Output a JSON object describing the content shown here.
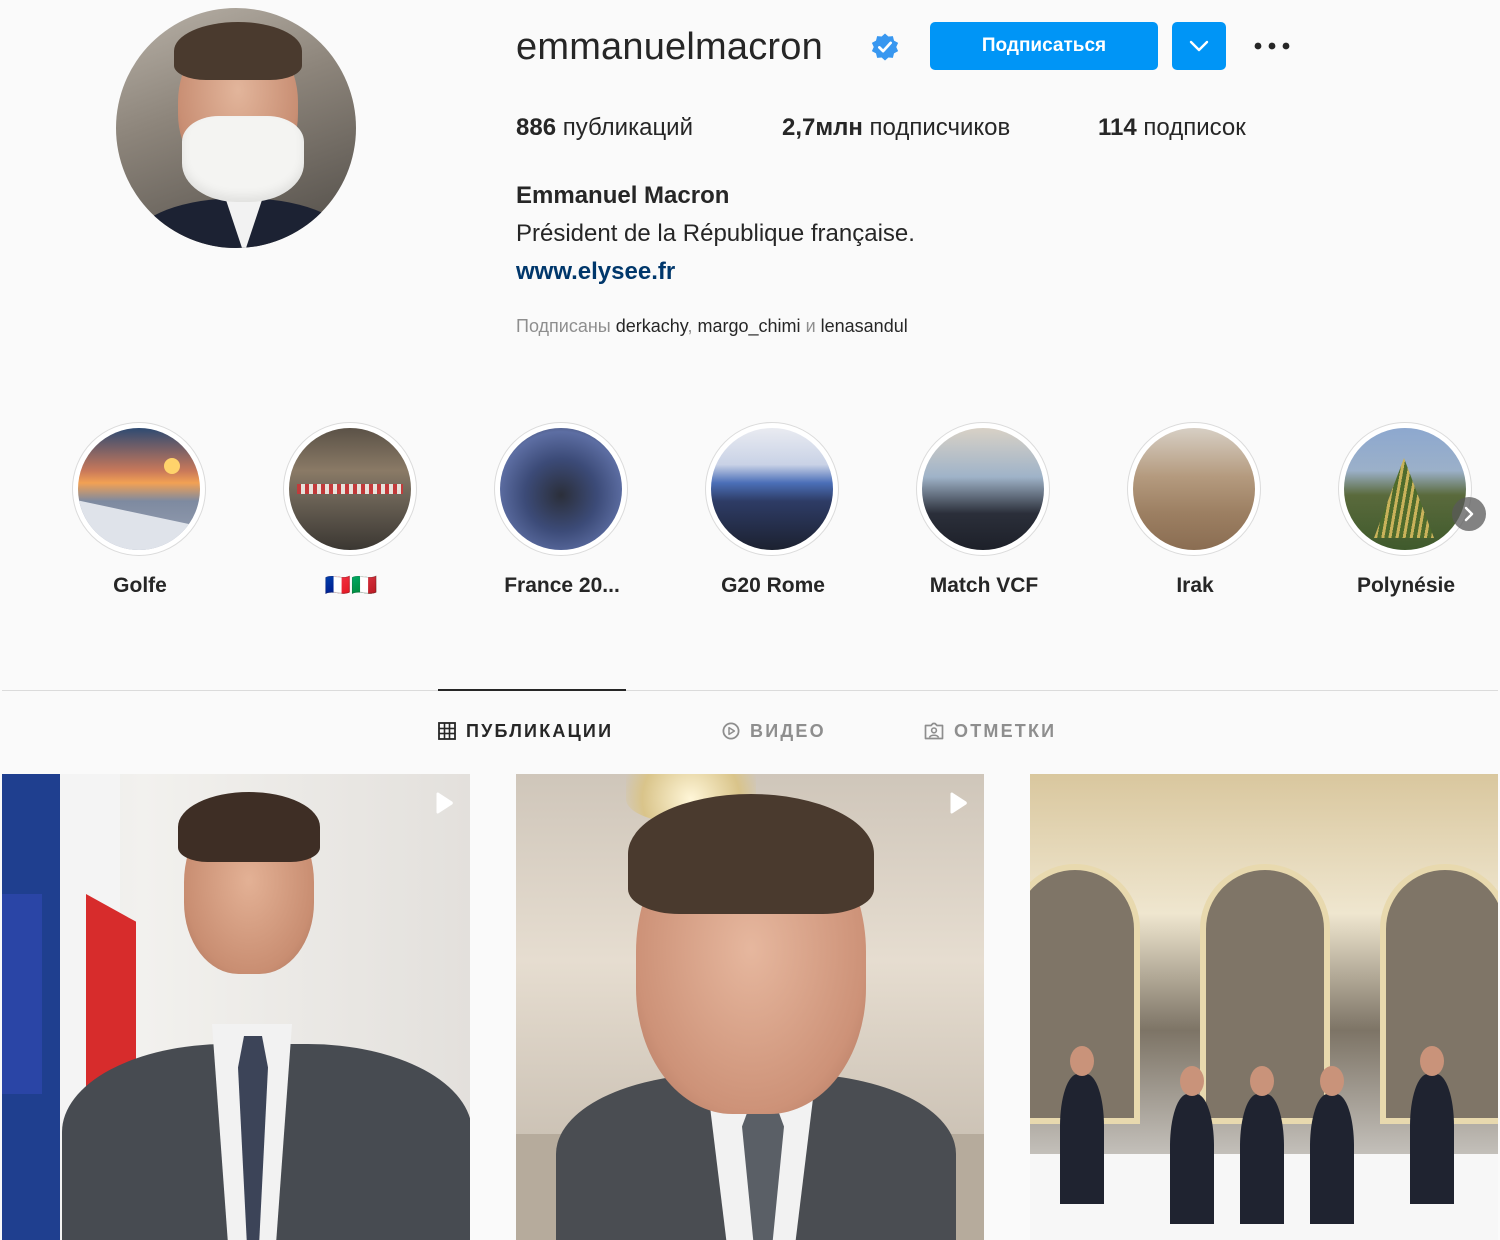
{
  "profile": {
    "username": "emmanuelmacron",
    "verified": true,
    "follow_label": "Подписаться",
    "stats": {
      "posts_value": "886",
      "posts_label": "публикаций",
      "followers_value": "2,7млн",
      "followers_label": "подписчиков",
      "following_value": "114",
      "following_label": "подписок"
    },
    "full_name": "Emmanuel Macron",
    "bio": "Président de la République française.",
    "website": "www.elysee.fr",
    "followed_by": {
      "prefix": "Подписаны",
      "users": [
        "derkachy",
        "margo_chimi",
        "lenasandul"
      ],
      "separator": ",",
      "conjunction": "и"
    }
  },
  "highlights": [
    {
      "label": "Golfe"
    },
    {
      "label": "🇫🇷🇮🇹"
    },
    {
      "label": "France 20..."
    },
    {
      "label": "G20 Rome"
    },
    {
      "label": "Match VCF"
    },
    {
      "label": "Irak"
    },
    {
      "label": "Polynésie"
    }
  ],
  "tabs": [
    {
      "label": "ПУБЛИКАЦИИ",
      "active": true,
      "icon": "grid-icon"
    },
    {
      "label": "ВИДЕО",
      "active": false,
      "icon": "video-icon"
    },
    {
      "label": "ОТМЕТКИ",
      "active": false,
      "icon": "tagged-icon"
    }
  ],
  "posts": [
    {
      "type": "video",
      "icon": "play-icon"
    },
    {
      "type": "video",
      "icon": "play-icon"
    },
    {
      "type": "image"
    }
  ],
  "colors": {
    "accent": "#0095f6",
    "verified": "#3897f0",
    "link": "#00376b",
    "secondary_text": "#8e8e8e"
  }
}
